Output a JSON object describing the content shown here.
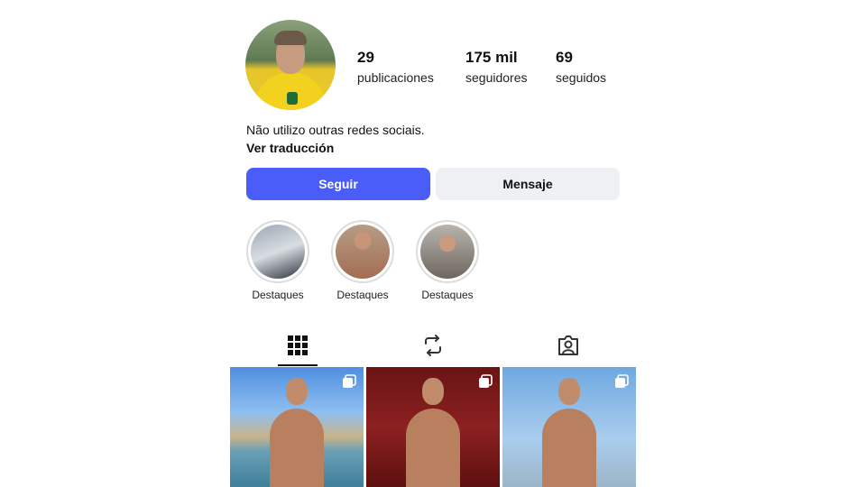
{
  "profile": {
    "stats": {
      "posts": {
        "value": "29",
        "label": "publicaciones"
      },
      "followers": {
        "value": "175 mil",
        "label": "seguidores"
      },
      "following": {
        "value": "69",
        "label": "seguidos"
      }
    },
    "bio": "Não utilizo outras redes sociais.",
    "translate_link": "Ver traducción",
    "actions": {
      "follow_label": "Seguir",
      "message_label": "Mensaje"
    },
    "highlights": [
      {
        "label": "Destaques"
      },
      {
        "label": "Destaques"
      },
      {
        "label": "Destaques"
      }
    ],
    "tabs": [
      {
        "icon": "grid-icon",
        "active": true
      },
      {
        "icon": "reels-repost-icon",
        "active": false
      },
      {
        "icon": "tagged-person-icon",
        "active": false
      }
    ],
    "posts": [
      {
        "icon": "multiple-posts-icon"
      },
      {
        "icon": "multiple-posts-icon"
      },
      {
        "icon": "multiple-posts-icon"
      }
    ]
  },
  "colors": {
    "follow_button": "#4a5df9",
    "message_button": "#eff0f3",
    "text": "#111111"
  }
}
